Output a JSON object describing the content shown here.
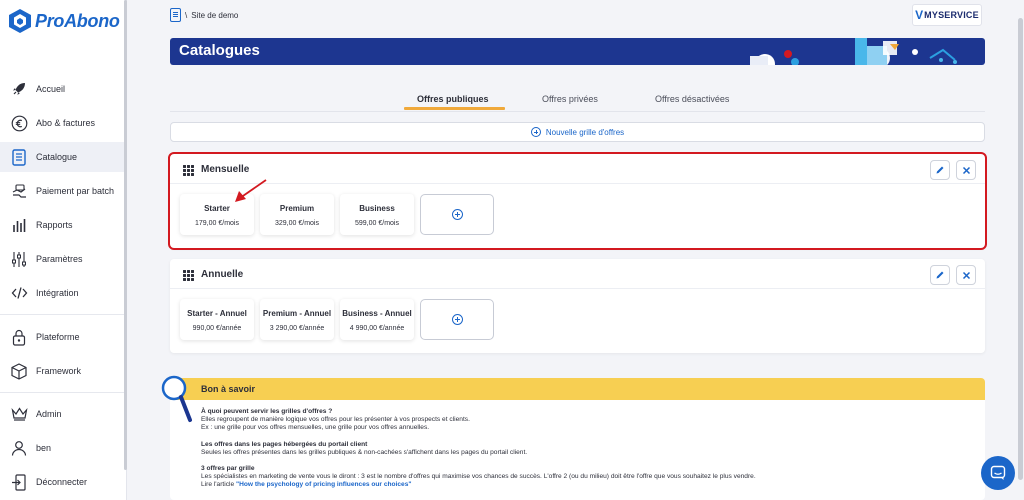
{
  "app": {
    "logo_text": "ProAbono",
    "brand_color": "#1b66c9",
    "accent_color": "#f0a93b",
    "highlight_color": "#d31920"
  },
  "header": {
    "breadcrumb_sep": "\\",
    "breadcrumb_site": "Site de demo",
    "partner_prefix": "V",
    "partner_name": "MYSERVICE"
  },
  "sidebar": {
    "items": [
      {
        "label": "Accueil",
        "icon": "rocket-icon"
      },
      {
        "label": "Abo & factures",
        "icon": "euro-icon"
      },
      {
        "label": "Catalogue",
        "icon": "catalog-icon",
        "active": true
      },
      {
        "label": "Paiement par batch",
        "icon": "batch-payment-icon"
      },
      {
        "label": "Rapports",
        "icon": "reports-icon"
      },
      {
        "label": "Paramètres",
        "icon": "settings-sliders-icon"
      },
      {
        "label": "Intégration",
        "icon": "code-icon"
      },
      {
        "label": "Plateforme",
        "icon": "lock-icon"
      },
      {
        "label": "Framework",
        "icon": "cube-icon"
      },
      {
        "label": "Admin",
        "icon": "crown-icon"
      },
      {
        "label": "ben",
        "icon": "user-icon"
      },
      {
        "label": "Déconnecter",
        "icon": "logout-icon"
      }
    ]
  },
  "page": {
    "title": "Catalogues"
  },
  "tabs": [
    {
      "label": "Offres publiques",
      "active": true
    },
    {
      "label": "Offres privées"
    },
    {
      "label": "Offres désactivées"
    }
  ],
  "new_grid_label": "Nouvelle grille d'offres",
  "grids": [
    {
      "title": "Mensuelle",
      "offers": [
        {
          "name": "Starter",
          "price": "179,00 €/mois"
        },
        {
          "name": "Premium",
          "price": "329,00 €/mois"
        },
        {
          "name": "Business",
          "price": "599,00 €/mois"
        }
      ]
    },
    {
      "title": "Annuelle",
      "offers": [
        {
          "name": "Starter - Annuel",
          "price": "990,00 €/année"
        },
        {
          "name": "Premium - Annuel",
          "price": "3 290,00 €/année"
        },
        {
          "name": "Business - Annuel",
          "price": "4 990,00 €/année"
        }
      ]
    }
  ],
  "info": {
    "title": "Bon à savoir",
    "q1": "À quoi peuvent servir les grilles d'offres ?",
    "a1_l1": "Elles regroupent de manière logique vos offres pour les présenter à vos prospects et clients.",
    "a1_l2": "Ex : une grille pour vos offres mensuelles, une grille pour vos offres annuelles.",
    "q2": "Les offres dans les pages hébergées du portail client",
    "a2": "Seules les offres présentes dans les grilles publiques & non-cachées s'affichent dans les pages du portail client.",
    "q3": "3 offres par grille",
    "a3": "Les spécialistes en marketing de vente vous le diront : 3 est le nombre d'offres qui maximise vos chances de succès. L'offre 2 (ou du milieu) doit être l'offre que vous souhaitez le plus vendre.",
    "a3_link_prefix": "Lire l'article ",
    "a3_link": "\"How the psychology of pricing influences our choices\""
  }
}
